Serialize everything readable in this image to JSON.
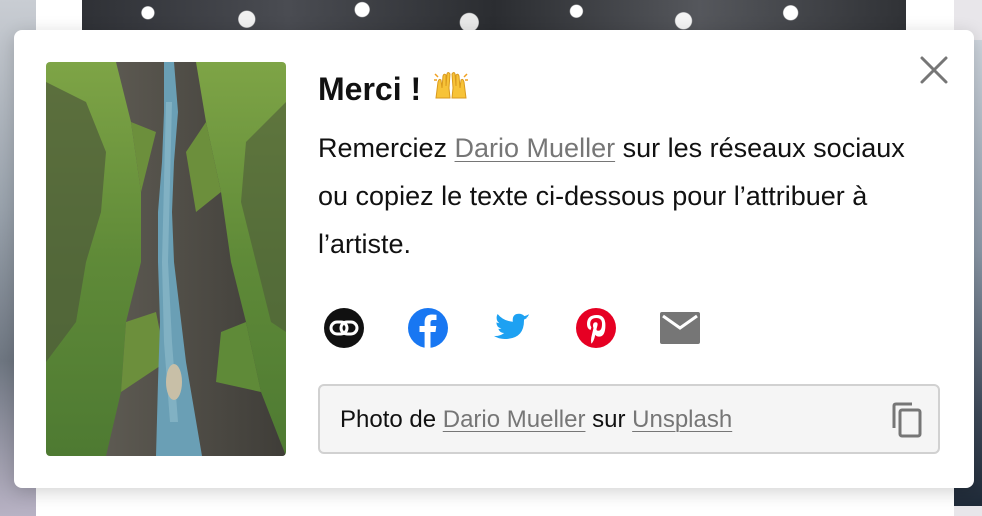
{
  "dialog": {
    "title": "Merci !",
    "title_emoji": "🙌",
    "description": {
      "before": "Remerciez ",
      "author": "Dario Mueller",
      "after": " sur les réseaux sociaux ou copiez le texte ci-dessous pour l’attribuer à l’artiste."
    },
    "share": [
      {
        "icon": "link-icon",
        "color": "#111111"
      },
      {
        "icon": "facebook-icon",
        "color": "#1877f2"
      },
      {
        "icon": "twitter-icon",
        "color": "#1da1f2"
      },
      {
        "icon": "pinterest-icon",
        "color": "#e60023"
      },
      {
        "icon": "email-icon",
        "color": "#767676"
      }
    ],
    "attribution": {
      "prefix": "Photo de ",
      "author": "Dario Mueller",
      "middle": " sur ",
      "site": "Unsplash"
    },
    "close_icon": "close-icon",
    "copy_icon": "copy-icon",
    "photo": "canyon-river-photo"
  },
  "colors": {
    "link": "#767676",
    "text": "#111111",
    "box_bg": "#f5f5f5",
    "box_border": "#d1d1d1"
  }
}
